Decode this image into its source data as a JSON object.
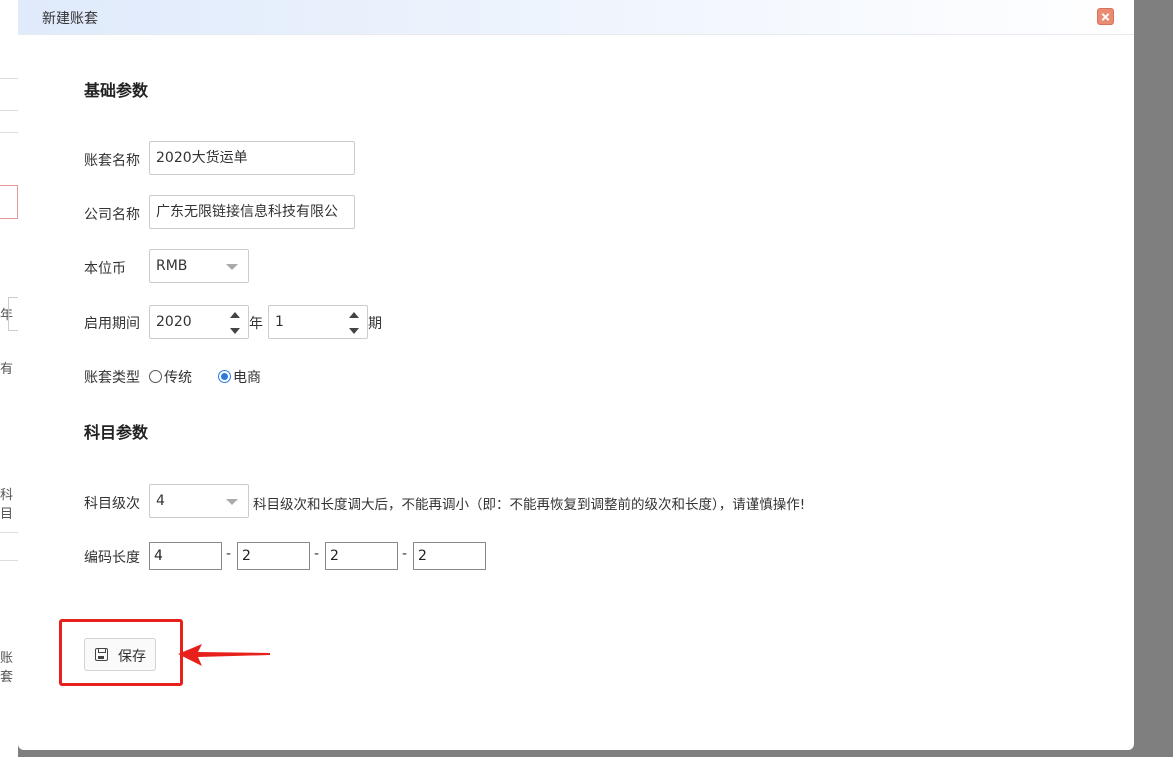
{
  "dialog": {
    "title": "新建账套"
  },
  "background": {
    "frag1": "年",
    "frag2": "有",
    "frag3": "科目",
    "frag4": "账套"
  },
  "basic": {
    "section_title": "基础参数",
    "account_name_label": "账套名称",
    "account_name_value": "2020大货运单",
    "company_label": "公司名称",
    "company_value": "广东无限链接信息科技有限公",
    "currency_label": "本位币",
    "currency_value": "RMB",
    "period_label": "启用期间",
    "year_value": "2020",
    "year_unit": "年",
    "period_value": "1",
    "period_unit": "期",
    "type_label": "账套类型",
    "type_options": [
      "传统",
      "电商"
    ],
    "type_selected": "电商"
  },
  "subject": {
    "section_title": "科目参数",
    "level_label": "科目级次",
    "level_value": "4",
    "level_note": "科目级次和长度调大后，不能再调小（即：不能再恢复到调整前的级次和长度），请谨慎操作!",
    "code_length_label": "编码长度",
    "code_lengths": [
      "4",
      "2",
      "2",
      "2"
    ],
    "separator": "-"
  },
  "actions": {
    "save_label": "保存"
  },
  "colors": {
    "accent": "#2a7ae2",
    "highlight": "#e8201b",
    "close": "#e98c73"
  }
}
